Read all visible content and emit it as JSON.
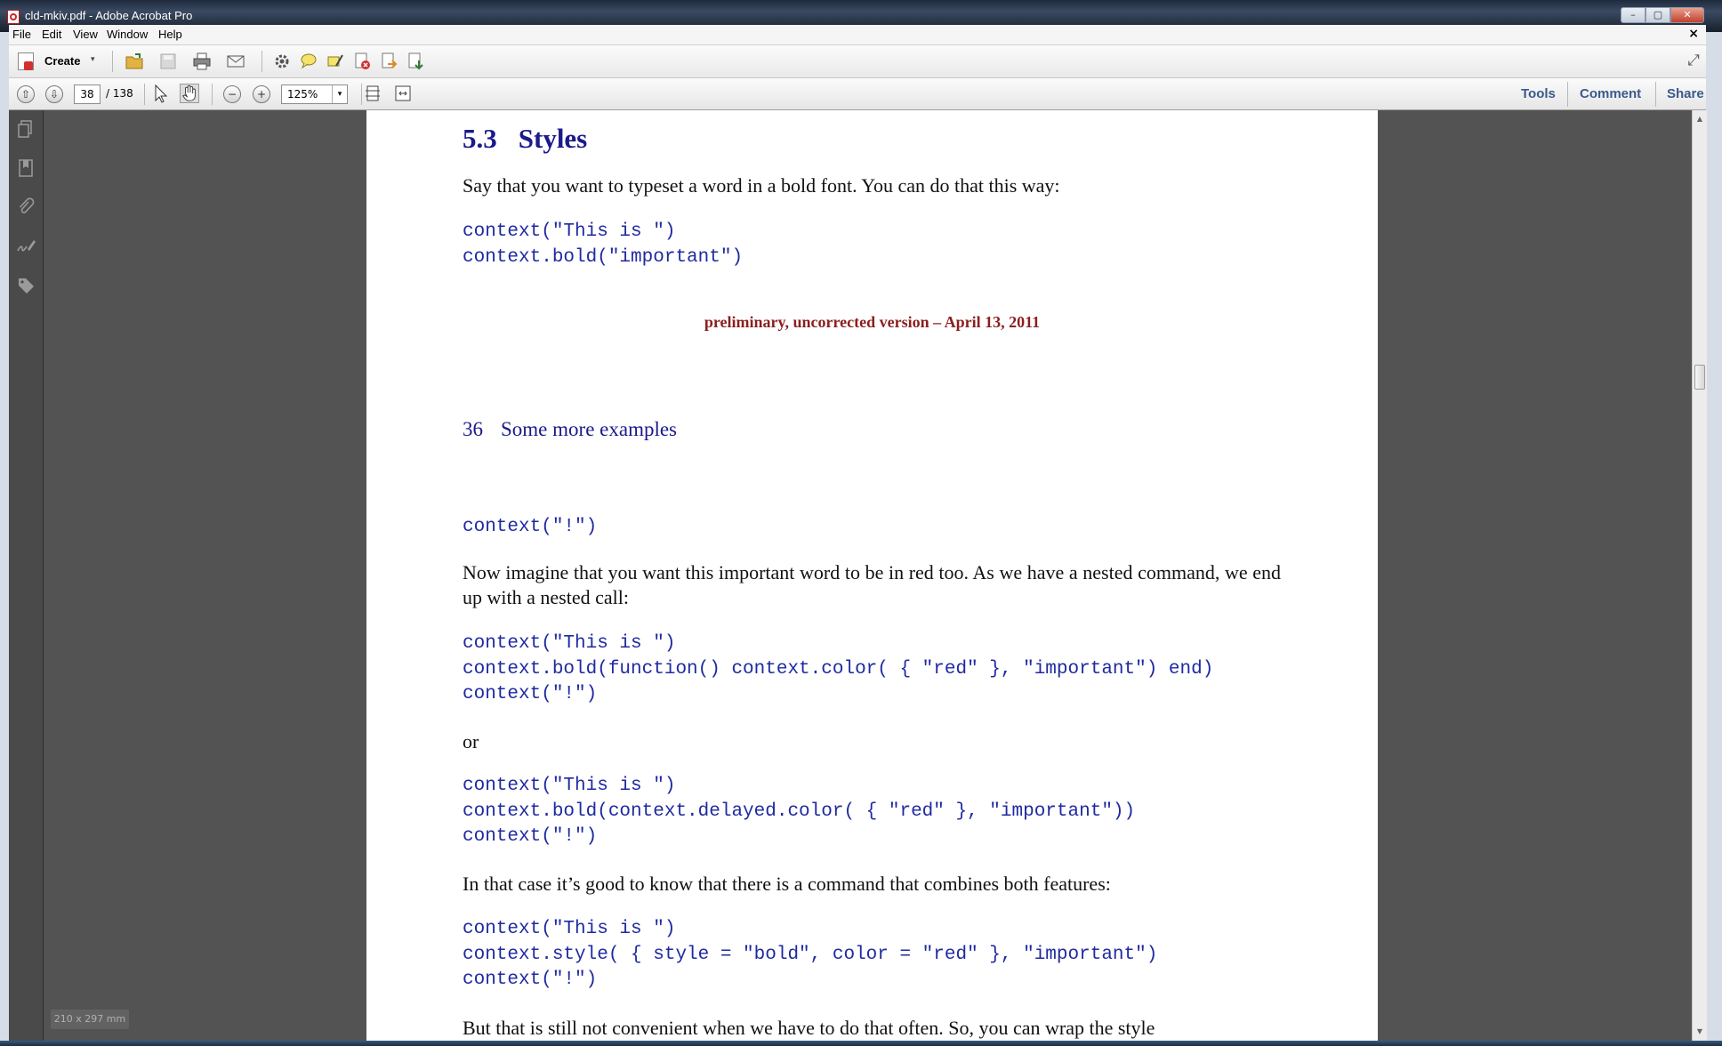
{
  "window": {
    "title": "cld-mkiv.pdf - Adobe Acrobat Pro",
    "min_glyph": "–",
    "max_glyph": "▢",
    "close_glyph": "✕"
  },
  "menu": {
    "items": [
      "File",
      "Edit",
      "View",
      "Window",
      "Help"
    ],
    "close_glyph": "×"
  },
  "toolbar": {
    "create_label": "Create",
    "create_caret": "▾",
    "expand_glyph": "⤢"
  },
  "nav": {
    "current_page": "38",
    "total_pages": "/ 138",
    "zoom": "125%",
    "zoom_caret": "▾",
    "up_glyph": "⇧",
    "down_glyph": "⇩",
    "zoom_out_glyph": "−",
    "zoom_in_glyph": "+"
  },
  "links": {
    "tools": "Tools",
    "comment": "Comment",
    "share": "Share"
  },
  "status": {
    "page_size": "210 x 297 mm"
  },
  "page_a": {
    "section_number": "5.3",
    "section_title": "Styles",
    "intro": "Say that you want to typeset a word in a bold font. You can do that this way:",
    "code": "context(\"This is \")\ncontext.bold(\"important\")",
    "footer": "preliminary, uncorrected version – April 13, 2011"
  },
  "page_b": {
    "page_number": "36",
    "running_title": "Some more examples",
    "code1": "context(\"!\")",
    "para1": "Now imagine that you want this important word to be in red too. As we have a nested command, we end up with a nested call:",
    "code2": "context(\"This is \")\ncontext.bold(function() context.color( { \"red\" }, \"important\") end)\ncontext(\"!\")",
    "para_or": "or",
    "code3": "context(\"This is \")\ncontext.bold(context.delayed.color( { \"red\" }, \"important\"))\ncontext(\"!\")",
    "para2": "In that case it’s good to know that there is a command that combines both features:",
    "code4": "context(\"This is \")\ncontext.style( { style = \"bold\", color = \"red\" }, \"important\")\ncontext(\"!\")",
    "para3": "But that is still not convenient when we have to do that often. So, you can wrap the style"
  },
  "colors": {
    "heading": "#1a1a8c",
    "code": "#1f2aa0",
    "footer": "#8b1e1e",
    "link": "#3a5a8c"
  }
}
